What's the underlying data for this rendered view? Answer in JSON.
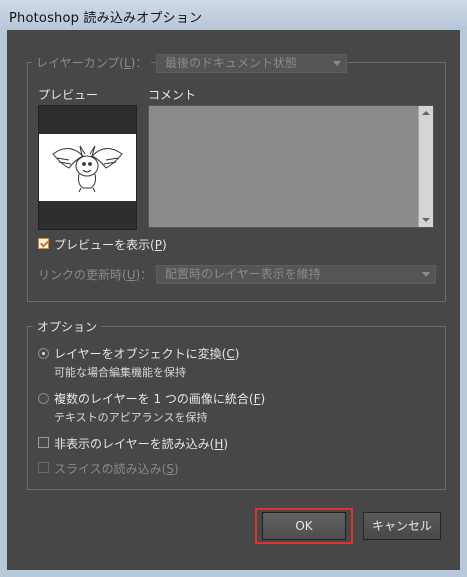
{
  "window": {
    "title": "Photoshop 読み込みオプション"
  },
  "layer_comp": {
    "label": "レイヤーカンプ(",
    "shortcut": "L",
    "label_end": ")：",
    "value": "最後のドキュメント状態"
  },
  "preview": {
    "label": "プレビュー"
  },
  "comment": {
    "label": "コメント"
  },
  "show_preview": {
    "label": "プレビューを表示(",
    "shortcut": "P",
    "label_end": ")",
    "checked": true
  },
  "link_update": {
    "label": "リンクの更新時(",
    "shortcut": "U",
    "label_end": ")：",
    "value": "配置時のレイヤー表示を維持"
  },
  "options": {
    "legend": "オプション",
    "radio1": {
      "label": "レイヤーをオブジェクトに変換(",
      "shortcut": "C",
      "label_end": ")",
      "sub": "可能な場合編集機能を保持",
      "checked": true
    },
    "radio2": {
      "label": "複数のレイヤーを 1 つの画像に統合(",
      "shortcut": "F",
      "label_end": ")",
      "sub": "テキストのアピアランスを保持",
      "checked": false
    },
    "import_hidden": {
      "label": "非表示のレイヤーを読み込み(",
      "shortcut": "H",
      "label_end": ")",
      "checked": false
    },
    "import_slices": {
      "label": "スライスの読み込み(",
      "shortcut": "S",
      "label_end": ")",
      "checked": false,
      "disabled": true
    }
  },
  "buttons": {
    "ok": "OK",
    "cancel": "キャンセル"
  },
  "colors": {
    "highlight": "#e03030",
    "checkbox_accent": "#d07a10"
  }
}
